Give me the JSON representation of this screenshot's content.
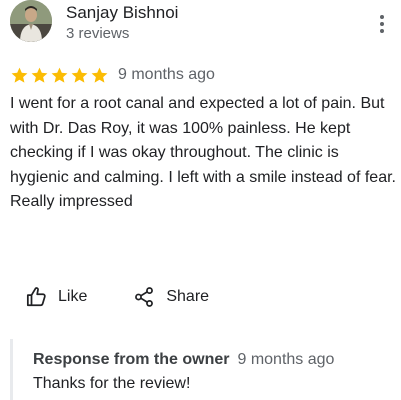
{
  "review": {
    "reviewer": {
      "name": "Sanjay Bishnoi",
      "meta": "3 reviews",
      "avatar_icon": "reviewer-avatar-photo"
    },
    "menu_icon": "more-vert-icon",
    "rating": 5,
    "max_rating": 5,
    "star_color": "#fbbc04",
    "date": "9 months ago",
    "text": "I went for a root canal and expected a lot of pain. But with Dr. Das Roy, it was 100% painless. He kept checking if I was okay throughout. The clinic is hygienic and calming. I left with a smile instead of fear. Really impressed",
    "actions": {
      "like_label": "Like",
      "like_icon": "thumb-up-icon",
      "share_label": "Share",
      "share_icon": "share-icon"
    },
    "owner_response": {
      "title": "Response from the owner",
      "date": "9 months ago",
      "text": "Thanks for the review!"
    }
  }
}
